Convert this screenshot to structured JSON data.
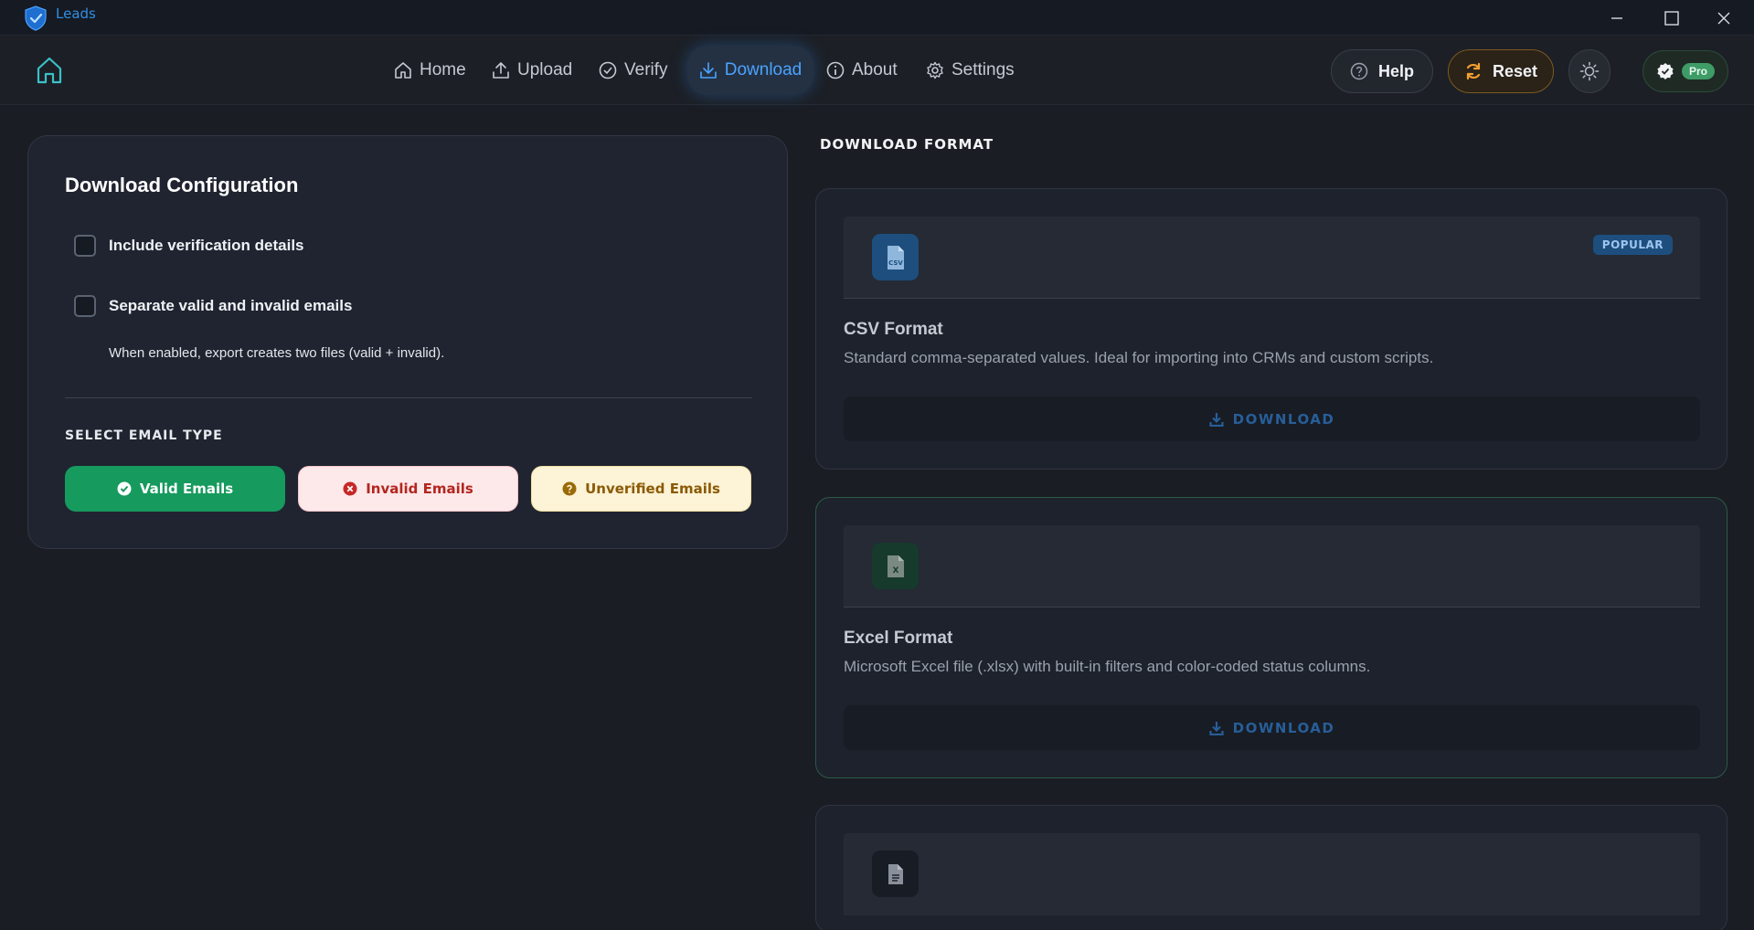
{
  "app": {
    "name": "Leads"
  },
  "nav": {
    "items": [
      {
        "label": "Home",
        "icon": "home-icon"
      },
      {
        "label": "Upload",
        "icon": "upload-icon"
      },
      {
        "label": "Verify",
        "icon": "check-circle-icon"
      },
      {
        "label": "Download",
        "icon": "download-icon",
        "active": true
      },
      {
        "label": "About",
        "icon": "info-icon"
      },
      {
        "label": "Settings",
        "icon": "gear-icon"
      }
    ],
    "help_label": "Help",
    "reset_label": "Reset",
    "pro_label": "Pro"
  },
  "config": {
    "title": "Download Configuration",
    "include_details_label": "Include verification details",
    "include_details_checked": false,
    "separate_label": "Separate valid and invalid emails",
    "separate_checked": false,
    "separate_hint": "When enabled, export creates two files (valid + invalid).",
    "email_type_heading": "SELECT EMAIL TYPE",
    "email_types": [
      {
        "label": "Valid Emails",
        "selected": true
      },
      {
        "label": "Invalid Emails",
        "selected": false
      },
      {
        "label": "Unverified Emails",
        "selected": false
      }
    ]
  },
  "formats": {
    "heading": "DOWNLOAD FORMAT",
    "items": [
      {
        "name": "CSV Format",
        "description": "Standard comma-separated values. Ideal for importing into CRMs and custom scripts.",
        "badge": "POPULAR",
        "icon_text": "CSV",
        "download_label": "DOWNLOAD"
      },
      {
        "name": "Excel Format",
        "description": "Microsoft Excel file (.xlsx) with built-in filters and color-coded status columns.",
        "icon_text": "X",
        "download_label": "DOWNLOAD"
      },
      {
        "icon": "document-icon"
      }
    ]
  },
  "colors": {
    "accent_blue": "#4aa3ff",
    "valid_green": "#169a5e",
    "invalid_red": "#b3261e",
    "unverified_amber": "#8a5a06",
    "reset_orange": "#f4a030"
  }
}
